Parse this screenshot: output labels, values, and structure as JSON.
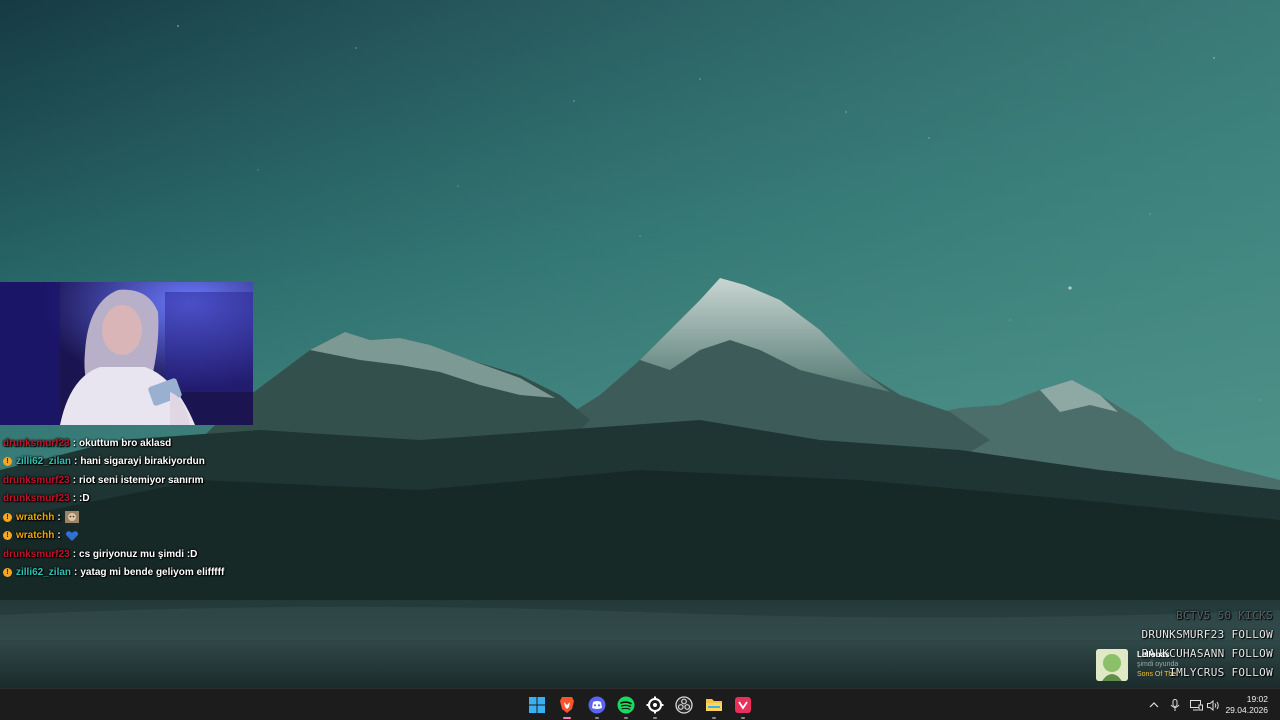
{
  "chat": {
    "messages": [
      {
        "user": "drunksmurf23",
        "text": "okuttum bro aklasd",
        "badge": false,
        "color": "#c0142a",
        "emote": null
      },
      {
        "user": "zilli62_zilan",
        "text": "hani sigarayi birakiyordun",
        "badge": true,
        "color": "#2ec4b6",
        "emote": null
      },
      {
        "user": "drunksmurf23",
        "text": "riot seni istemiyor sanırım",
        "badge": false,
        "color": "#c0142a",
        "emote": null
      },
      {
        "user": "drunksmurf23",
        "text": ":D",
        "badge": false,
        "color": "#c0142a",
        "emote": null
      },
      {
        "user": "wratchh",
        "text": "",
        "badge": true,
        "color": "#f0a500",
        "emote": "cat-emote"
      },
      {
        "user": "wratchh",
        "text": "",
        "badge": true,
        "color": "#f0a500",
        "emote": "blue-heart-emote"
      },
      {
        "user": "drunksmurf23",
        "text": "cs giriyonuz mu şimdi :D",
        "badge": false,
        "color": "#c0142a",
        "emote": null
      },
      {
        "user": "zilli62_zilan",
        "text": "yatag mi bende geliyom elifffff",
        "badge": true,
        "color": "#2ec4b6",
        "emote": null
      }
    ],
    "separator": ":"
  },
  "follows": [
    "BCTV5 50 KICKS",
    "DRUNKSMURF23 FOLLOW",
    "BAUKCUHASANN FOLLOW",
    "IMLYCRUS FOLLOW"
  ],
  "now_playing": {
    "title": "Lellonas",
    "status": "şimdi oyunda",
    "song": "Sons Of The"
  },
  "taskbar": {
    "apps": [
      {
        "name": "windows-start",
        "icon": "windows-logo-icon",
        "color": "#3ab0f0"
      },
      {
        "name": "brave-browser",
        "icon": "brave-lion-icon",
        "color": "#fb542b"
      },
      {
        "name": "discord",
        "icon": "discord-icon",
        "color": "#5865f2"
      },
      {
        "name": "spotify",
        "icon": "spotify-icon",
        "color": "#1ed760"
      },
      {
        "name": "steelseries-gg",
        "icon": "steelseries-icon",
        "color": "#ffffff"
      },
      {
        "name": "obs-studio",
        "icon": "obs-icon",
        "color": "#d8d8d8"
      },
      {
        "name": "file-explorer",
        "icon": "folder-icon",
        "color": "#f5c242"
      },
      {
        "name": "vpn-app",
        "icon": "shield-app-icon",
        "color": "#e8305a"
      }
    ],
    "tray": [
      "chevron-up-icon",
      "microphone-icon",
      "display-icon",
      "speaker-icon"
    ],
    "time": "19:02",
    "date": "29.04.2026"
  }
}
